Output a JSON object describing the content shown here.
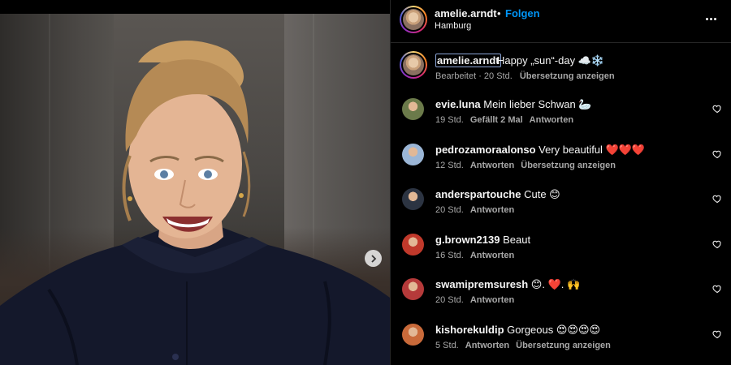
{
  "post": {
    "carousel_next_label": "next"
  },
  "header": {
    "username": "amelie.arndt",
    "separator": "•",
    "follow_label": "Folgen",
    "location": "Hamburg",
    "more_icon": "more-horizontal-icon"
  },
  "caption": {
    "username": "amelie.arndt",
    "text": "Happy „sun“-day ☁️❄️",
    "meta": "Bearbeitet · 20 Std.",
    "translate_label": "Übersetzung anzeigen"
  },
  "comments": [
    {
      "username": "evie.luna",
      "text": "Mein lieber Schwan 🦢",
      "time": "19 Std.",
      "actions": [
        "Gefällt 2 Mal",
        "Antworten"
      ],
      "avatar_color": "#6b7a4a"
    },
    {
      "username": "pedrozamoraalonso",
      "text": "Very beautiful ❤️❤️❤️",
      "time": "12 Std.",
      "actions": [
        "Antworten",
        "Übersetzung anzeigen"
      ],
      "avatar_color": "#9bb6d6"
    },
    {
      "username": "anderspartouche",
      "text": "Cute 😊",
      "time": "20 Std.",
      "actions": [
        "Antworten"
      ],
      "avatar_color": "#2c3442"
    },
    {
      "username": "g.brown2139",
      "text": "Beaut",
      "time": "16 Std.",
      "actions": [
        "Antworten"
      ],
      "avatar_color": "#c0392b"
    },
    {
      "username": "swamipremsuresh",
      "text": "😊. ❤️. 🙌",
      "time": "20 Std.",
      "actions": [
        "Antworten"
      ],
      "avatar_color": "#b53a3a"
    },
    {
      "username": "kishorekuldip",
      "text": "Gorgeous 😍😍😍😍",
      "time": "5 Std.",
      "actions": [
        "Antworten",
        "Übersetzung anzeigen"
      ],
      "avatar_color": "#c96a3a"
    }
  ]
}
